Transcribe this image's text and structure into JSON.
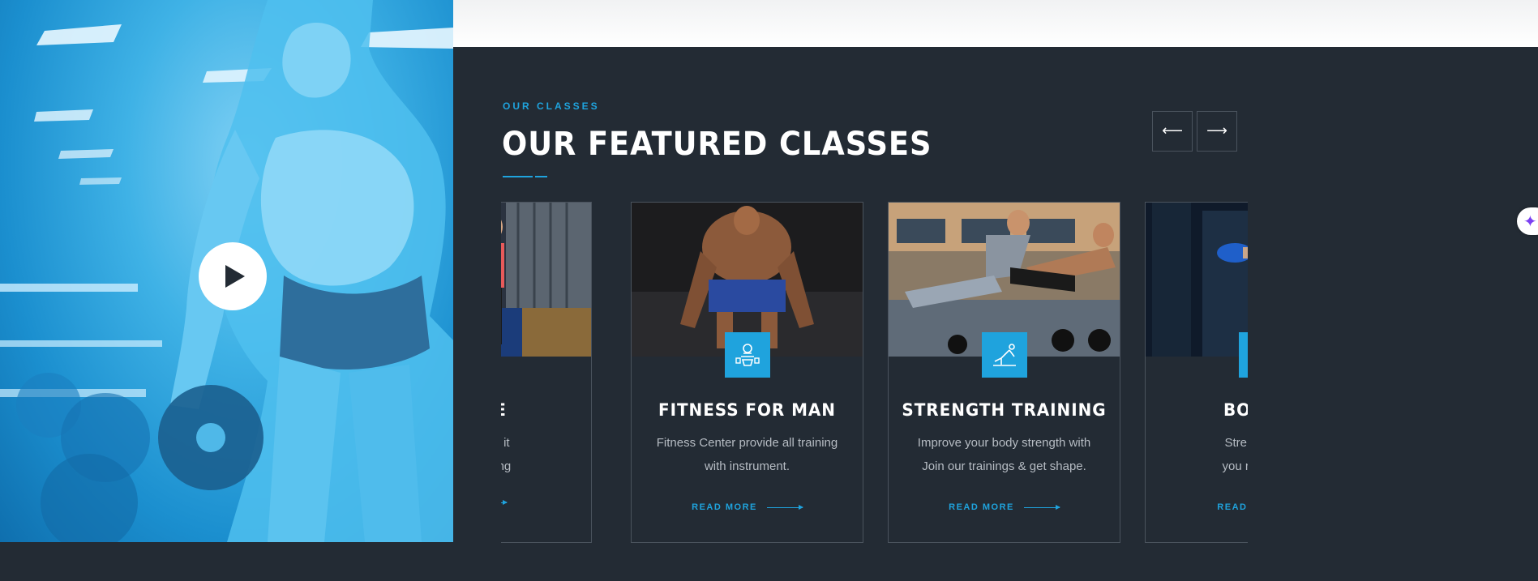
{
  "section": {
    "subtitle": "OUR CLASSES",
    "title": "OUR FEATURED CLASSES",
    "accent_color": "#1fa3dd",
    "background_color": "#232b34"
  },
  "hero": {
    "play_icon": "play-icon"
  },
  "carousel": {
    "prev_icon": "arrow-left-icon",
    "prev_symbol": "⟵",
    "next_icon": "arrow-right-icon",
    "next_symbol": "⟶",
    "cards": [
      {
        "title": "FENSE",
        "line1": "ntil you get it",
        "line2": "il can’t wrong",
        "read_more": ""
      },
      {
        "title": "FITNESS FOR MAN",
        "line1": "Fitness Center provide all training",
        "line2": "with instrument.",
        "read_more": "READ MORE"
      },
      {
        "title": "STRENGTH TRAINING",
        "line1": "Improve your body strength with",
        "line2": "Join our trainings & get shape.",
        "read_more": "READ MORE"
      },
      {
        "title": "BOXING",
        "line1": "Strength exer",
        "line2": "you realize inc",
        "read_more": "READ M"
      }
    ]
  },
  "widget": {
    "symbol": "✦",
    "icon": "sparkle-icon"
  }
}
